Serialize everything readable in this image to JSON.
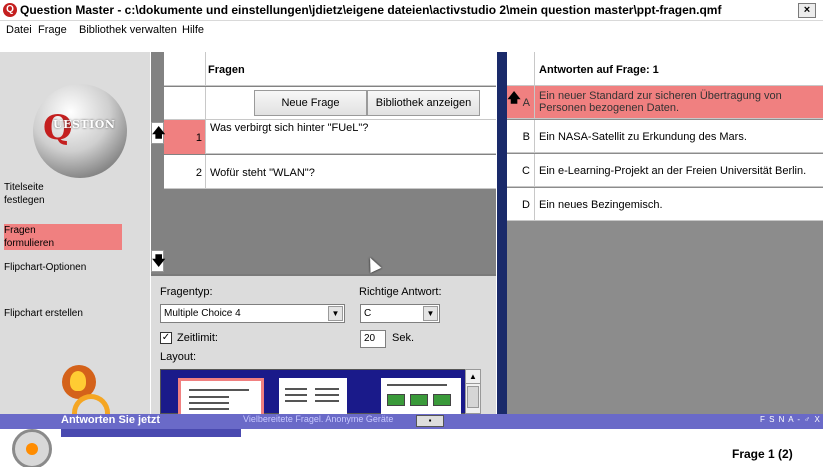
{
  "window": {
    "title": "Question Master - c:\\dokumente und einstellungen\\jdietz\\eigene dateien\\activstudio 2\\mein question master\\ppt-fragen.qmf",
    "close_glyph": "×",
    "app_icon_glyph": "Q"
  },
  "menu": {
    "items": [
      "Datei",
      "Frage",
      "Bibliothek verwalten",
      "Hilfe"
    ]
  },
  "sidebar": {
    "logo_text": "UESTION",
    "logo_letter": "Q",
    "items": [
      {
        "label_line1": "Titelseite",
        "label_line2": "festlegen"
      },
      {
        "label_line1": "Fragen",
        "label_line2": "formulieren"
      },
      {
        "label_line1": "Flipchart-Optionen",
        "label_line2": ""
      },
      {
        "label_line1": "Flipchart erstellen",
        "label_line2": ""
      }
    ]
  },
  "questions": {
    "header": "Fragen",
    "new_button": "Neue Frage",
    "library_button": "Bibliothek anzeigen",
    "rows": [
      {
        "num": "1",
        "text": "Was verbirgt sich hinter \"FUeL\"?"
      },
      {
        "num": "2",
        "text": "Wofür steht \"WLAN\"?"
      }
    ],
    "up_glyph": "🡅",
    "down_glyph": "🡇"
  },
  "form": {
    "type_label": "Fragentyp:",
    "type_value": "Multiple Choice 4",
    "correct_label": "Richtige Antwort:",
    "correct_value": "C",
    "timelimit_label": "Zeitlimit:",
    "timelimit_checked": "✓",
    "seconds_value": "20",
    "seconds_unit": "Sek.",
    "layout_label": "Layout:",
    "dropdown_glyph": "▼"
  },
  "answers": {
    "header": "Antworten auf Frage: 1",
    "rows": [
      {
        "letter": "A",
        "text": "Ein neuer Standard zur sicheren Übertragung von Personen bezogenen Daten."
      },
      {
        "letter": "B",
        "text": "Ein NASA-Satellit zu Erkundung des Mars."
      },
      {
        "letter": "C",
        "text": "Ein e-Learning-Projekt an der Freien Universität Berlin."
      },
      {
        "letter": "D",
        "text": "Ein neues Bezingemisch."
      }
    ]
  },
  "statusbar": {
    "title": "Antworten Sie jetzt",
    "middle": "Vielbereitete Fragel. Anonyme Geräte",
    "right": "F S N A - ♂ X",
    "min_glyph": "▪"
  },
  "footer": {
    "frage_label": "Frage 1 (2)"
  },
  "colors": {
    "selected": "#f08080",
    "divider": "#1a2a6a",
    "status": "#6a6ac8"
  }
}
